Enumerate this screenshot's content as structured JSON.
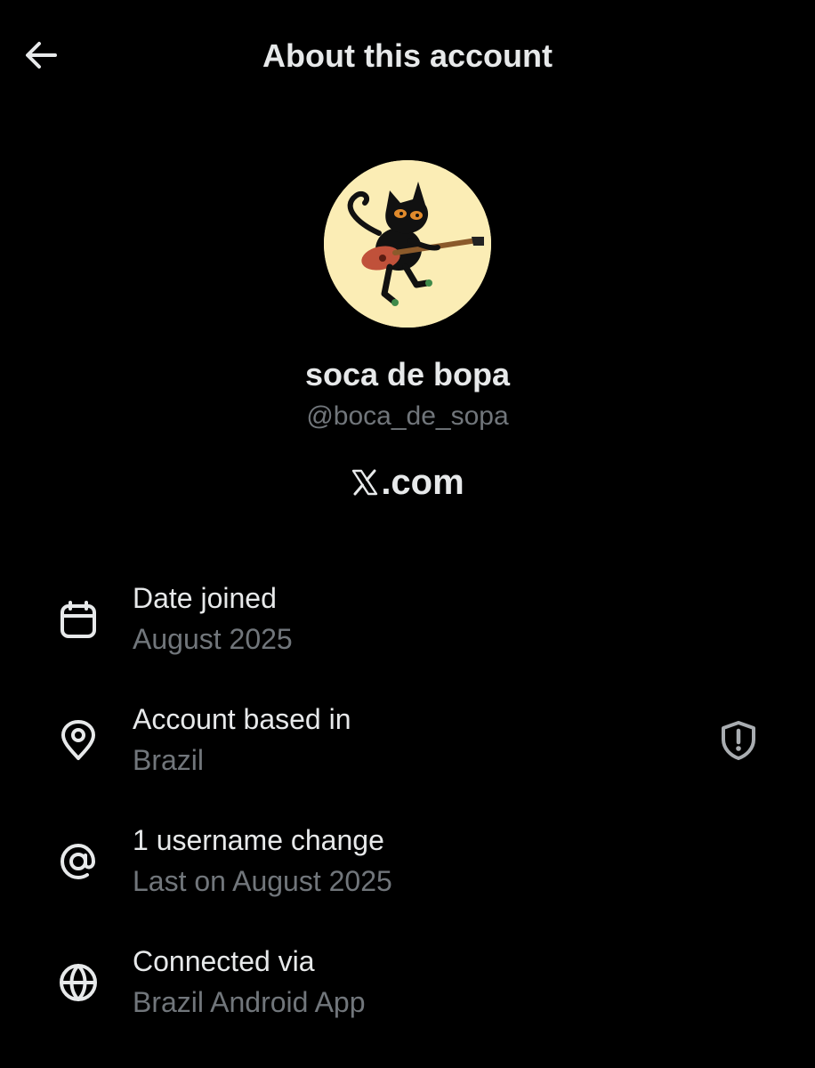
{
  "header": {
    "back_icon": "arrow-left-icon",
    "title": "About this account"
  },
  "profile": {
    "avatar_icon": "cat-playing-guitar-avatar",
    "display_name": "soca de bopa",
    "handle": "@boca_de_sopa",
    "brand_text": ".com",
    "brand_icon": "x-logo-icon"
  },
  "details": [
    {
      "icon": "calendar-icon",
      "label": "Date joined",
      "value": "August 2025"
    },
    {
      "icon": "location-pin-icon",
      "label": "Account based in",
      "value": "Brazil",
      "trailing_icon": "shield-alert-icon"
    },
    {
      "icon": "at-sign-icon",
      "label": "1 username change",
      "value": "Last on August 2025"
    },
    {
      "icon": "globe-icon",
      "label": "Connected via",
      "value": "Brazil Android App"
    }
  ],
  "colors": {
    "background": "#000000",
    "primary_text": "#e7e9ea",
    "secondary_text": "#71767b",
    "avatar_background": "#fbedb5"
  }
}
